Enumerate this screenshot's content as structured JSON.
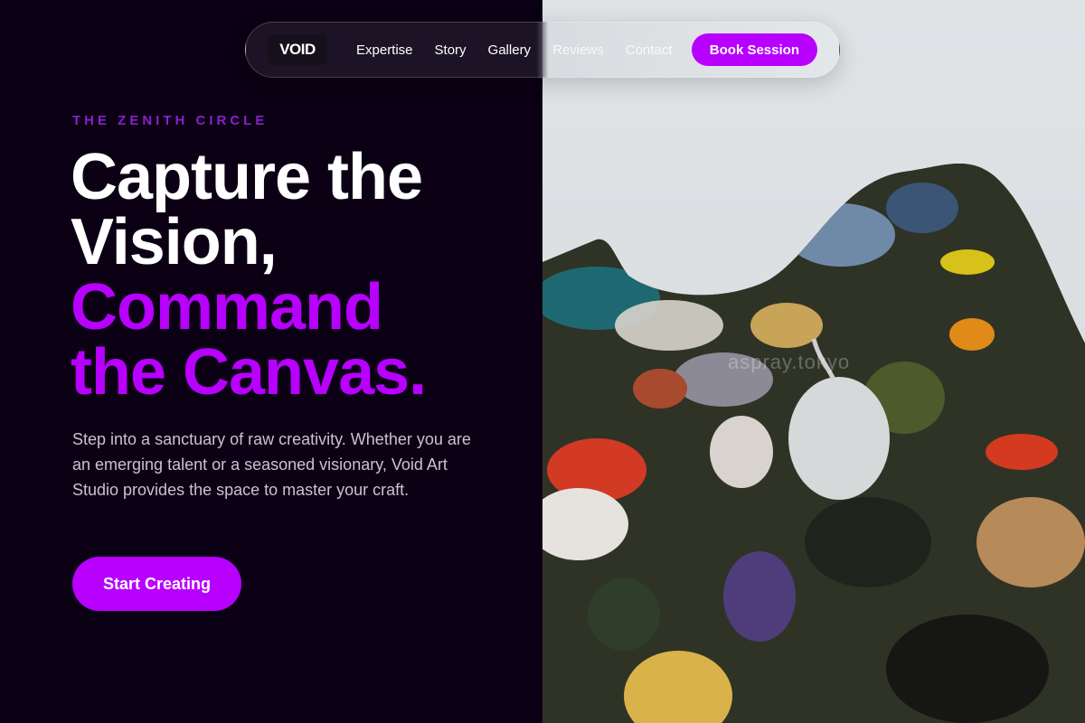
{
  "brand": {
    "logo_text": "VOID"
  },
  "nav": {
    "links": [
      {
        "label": "Expertise"
      },
      {
        "label": "Story"
      },
      {
        "label": "Gallery"
      },
      {
        "label": "Reviews"
      },
      {
        "label": "Contact"
      }
    ],
    "cta_label": "Book Session"
  },
  "hero": {
    "eyebrow": "THE ZENITH CIRCLE",
    "headline_line1": "Capture the",
    "headline_line2": "Vision,",
    "headline_line3": "Command",
    "headline_line4": "the Canvas.",
    "description": "Step into a sanctuary of raw creativity. Whether you are an emerging talent or a seasoned visionary, Void Art Studio provides the space to master your craft.",
    "cta_label": "Start Creating"
  },
  "image": {
    "watermark": "aspray.tokyo",
    "subject": "paint-palette-photo"
  },
  "colors": {
    "accent": "#b800ff",
    "background": "#0b0014",
    "eyebrow": "#8a1fd0"
  }
}
